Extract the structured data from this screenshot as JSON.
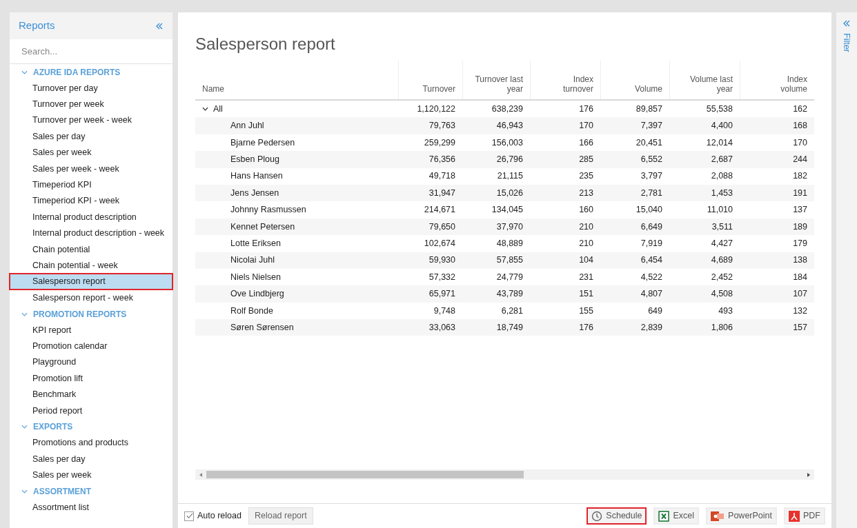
{
  "sidebar": {
    "title": "Reports",
    "search": {
      "placeholder": "Search..."
    },
    "groups": [
      {
        "label": "AZURE IDA REPORTS",
        "expanded": true,
        "items": [
          {
            "label": "Turnover per day",
            "selected": false
          },
          {
            "label": "Turnover per week",
            "selected": false
          },
          {
            "label": "Turnover per week - week",
            "selected": false
          },
          {
            "label": "Sales per day",
            "selected": false
          },
          {
            "label": "Sales per week",
            "selected": false
          },
          {
            "label": "Sales per week - week",
            "selected": false
          },
          {
            "label": "Timeperiod KPI",
            "selected": false
          },
          {
            "label": "Timeperiod KPI - week",
            "selected": false
          },
          {
            "label": "Internal product description",
            "selected": false
          },
          {
            "label": "Internal product description - week",
            "selected": false
          },
          {
            "label": "Chain potential",
            "selected": false
          },
          {
            "label": "Chain potential - week",
            "selected": false
          },
          {
            "label": "Salesperson report",
            "selected": true
          },
          {
            "label": "Salesperson report - week",
            "selected": false
          }
        ]
      },
      {
        "label": "PROMOTION REPORTS",
        "expanded": true,
        "items": [
          {
            "label": "KPI report",
            "selected": false
          },
          {
            "label": "Promotion calendar",
            "selected": false
          },
          {
            "label": "Playground",
            "selected": false
          },
          {
            "label": "Promotion lift",
            "selected": false
          },
          {
            "label": "Benchmark",
            "selected": false
          },
          {
            "label": "Period report",
            "selected": false
          }
        ]
      },
      {
        "label": "EXPORTS",
        "expanded": true,
        "items": [
          {
            "label": "Promotions and products",
            "selected": false
          },
          {
            "label": "Sales per day",
            "selected": false
          },
          {
            "label": "Sales per week",
            "selected": false
          }
        ]
      },
      {
        "label": "ASSORTMENT",
        "expanded": true,
        "items": [
          {
            "label": "Assortment list",
            "selected": false
          }
        ]
      }
    ]
  },
  "report": {
    "title": "Salesperson report",
    "table": {
      "columns": [
        "Name",
        "Turnover",
        "Turnover last year",
        "Index turnover",
        "Volume",
        "Volume last year",
        "Index volume"
      ],
      "total": {
        "label": "All",
        "expanded": true,
        "cells": [
          "1,120,122",
          "638,239",
          "176",
          "89,857",
          "55,538",
          "162"
        ]
      },
      "rows": [
        [
          "Ann Juhl",
          "79,763",
          "46,943",
          "170",
          "7,397",
          "4,400",
          "168"
        ],
        [
          "Bjarne Pedersen",
          "259,299",
          "156,003",
          "166",
          "20,451",
          "12,014",
          "170"
        ],
        [
          "Esben Ploug",
          "76,356",
          "26,796",
          "285",
          "6,552",
          "2,687",
          "244"
        ],
        [
          "Hans Hansen",
          "49,718",
          "21,115",
          "235",
          "3,797",
          "2,088",
          "182"
        ],
        [
          "Jens Jensen",
          "31,947",
          "15,026",
          "213",
          "2,781",
          "1,453",
          "191"
        ],
        [
          "Johnny Rasmussen",
          "214,671",
          "134,045",
          "160",
          "15,040",
          "11,010",
          "137"
        ],
        [
          "Kennet Petersen",
          "79,650",
          "37,970",
          "210",
          "6,649",
          "3,511",
          "189"
        ],
        [
          "Lotte Eriksen",
          "102,674",
          "48,889",
          "210",
          "7,919",
          "4,427",
          "179"
        ],
        [
          "Nicolai Juhl",
          "59,930",
          "57,855",
          "104",
          "6,454",
          "4,689",
          "138"
        ],
        [
          "Niels Nielsen",
          "57,332",
          "24,779",
          "231",
          "4,522",
          "2,452",
          "184"
        ],
        [
          "Ove Lindbjerg",
          "65,971",
          "43,789",
          "151",
          "4,807",
          "4,508",
          "107"
        ],
        [
          "Rolf Bonde",
          "9,748",
          "6,281",
          "155",
          "649",
          "493",
          "132"
        ],
        [
          "Søren Sørensen",
          "33,063",
          "18,749",
          "176",
          "2,839",
          "1,806",
          "157"
        ]
      ]
    }
  },
  "footer": {
    "auto_reload": {
      "label": "Auto reload",
      "checked": true
    },
    "reload_button": "Reload report",
    "exports": [
      {
        "kind": "schedule",
        "label": "Schedule",
        "highlighted": true
      },
      {
        "kind": "excel",
        "label": "Excel",
        "highlighted": false
      },
      {
        "kind": "powerpoint",
        "label": "PowerPoint",
        "highlighted": false
      },
      {
        "kind": "pdf",
        "label": "PDF",
        "highlighted": false
      }
    ]
  },
  "filter_panel": {
    "label": "Filter"
  }
}
